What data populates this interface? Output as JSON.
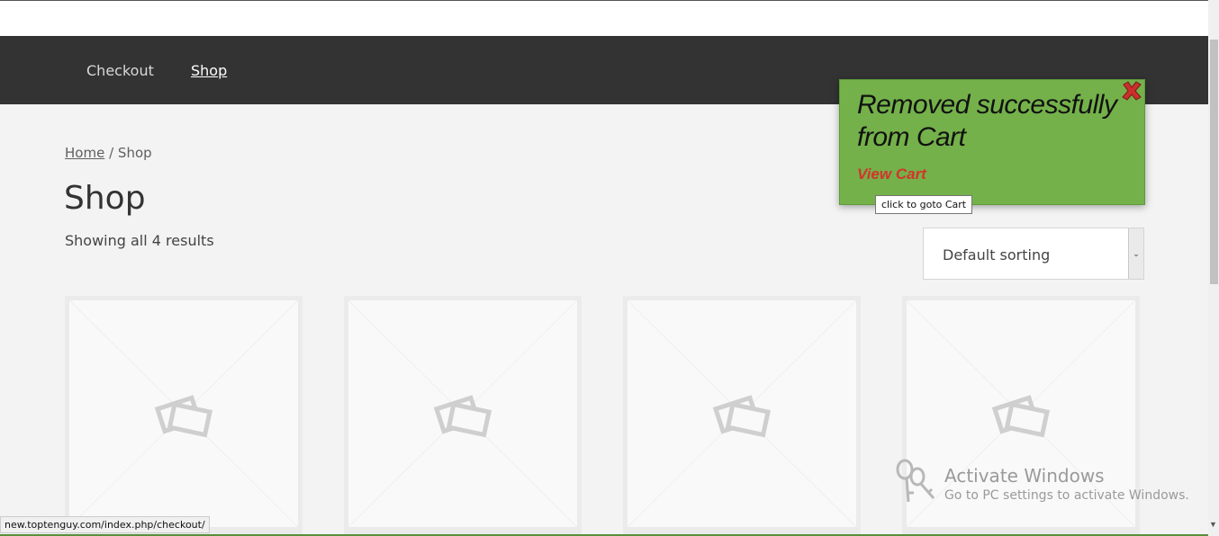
{
  "nav": {
    "items": [
      {
        "label": "Checkout"
      },
      {
        "label": "Shop"
      }
    ]
  },
  "breadcrumb": {
    "home": "Home",
    "separator": "/",
    "current": "Shop"
  },
  "page": {
    "title": "Shop",
    "result_count": "Showing all 4 results"
  },
  "sorting": {
    "selected": "Default sorting"
  },
  "products": [
    {
      "image": "placeholder-image"
    },
    {
      "image": "placeholder-image"
    },
    {
      "image": "placeholder-image"
    },
    {
      "image": "placeholder-image"
    }
  ],
  "notification": {
    "message": "Removed successfully from Cart",
    "link": "View Cart",
    "tooltip": "click to goto Cart",
    "close_icon": "close-x-icon",
    "background": "#74b14a",
    "link_color": "#d2352b"
  },
  "watermark": {
    "title": "Activate Windows",
    "subtitle": "Go to PC settings to activate Windows."
  },
  "status_bar": {
    "url": "new.toptenguy.com/index.php/checkout/"
  }
}
